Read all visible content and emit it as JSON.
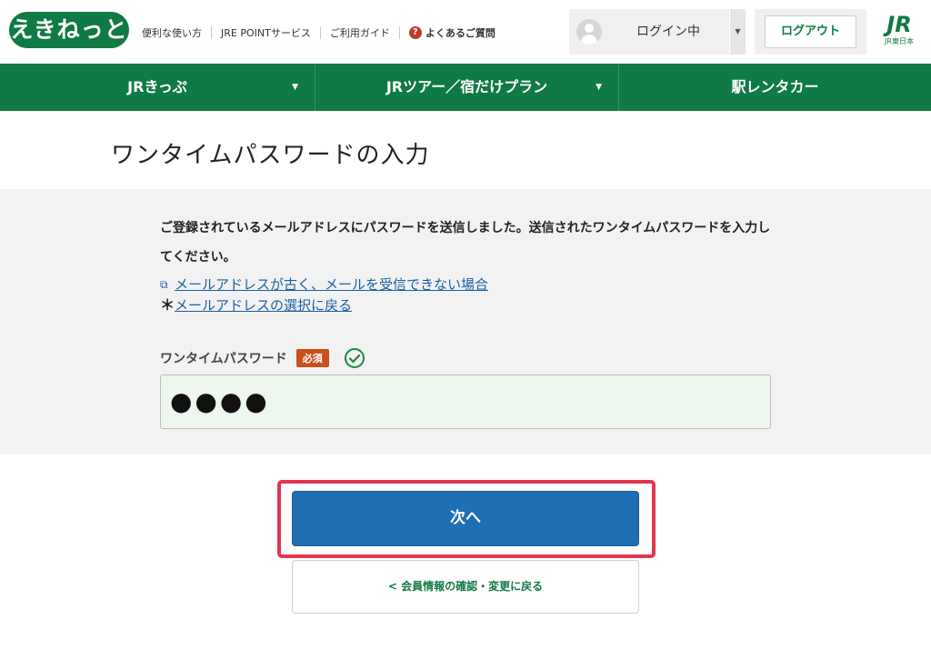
{
  "header": {
    "logo_text": "えきねっと",
    "nav_links": [
      "便利な使い方",
      "JRE POINTサービス",
      "ご利用ガイド"
    ],
    "faq_label": "よくあるご質問",
    "faq_icon": "?",
    "login_status": "ログイン中",
    "logout_label": "ログアウト",
    "jr_logo": "JR",
    "jr_subtext": "JR東日本"
  },
  "main_nav": [
    {
      "label": "JRきっぷ",
      "has_dropdown": true
    },
    {
      "label": "JRツアー／宿だけプラン",
      "has_dropdown": true
    },
    {
      "label": "駅レンタカー",
      "has_dropdown": false
    }
  ],
  "page": {
    "title": "ワンタイムパスワードの入力",
    "message": "ご登録されているメールアドレスにパスワードを送信しました。送信されたワンタイムパスワードを入力してください。",
    "link_cannot_receive": "メールアドレスが古く、メールを受信できない場合",
    "link_back_to_select": "メールアドレスの選択に戻る",
    "star_mark": "＊",
    "field_label": "ワンタイムパスワード",
    "required_badge": "必須",
    "password_value": "●●●●",
    "next_button": "次へ",
    "back_button": "会員情報の確認・変更に戻る",
    "back_chevron": "<"
  },
  "colors": {
    "brand_green": "#107a44",
    "primary_blue": "#1e6fb3",
    "required_orange": "#c8501e",
    "highlight_red": "#e0364f",
    "link_blue": "#1a5fa0"
  }
}
